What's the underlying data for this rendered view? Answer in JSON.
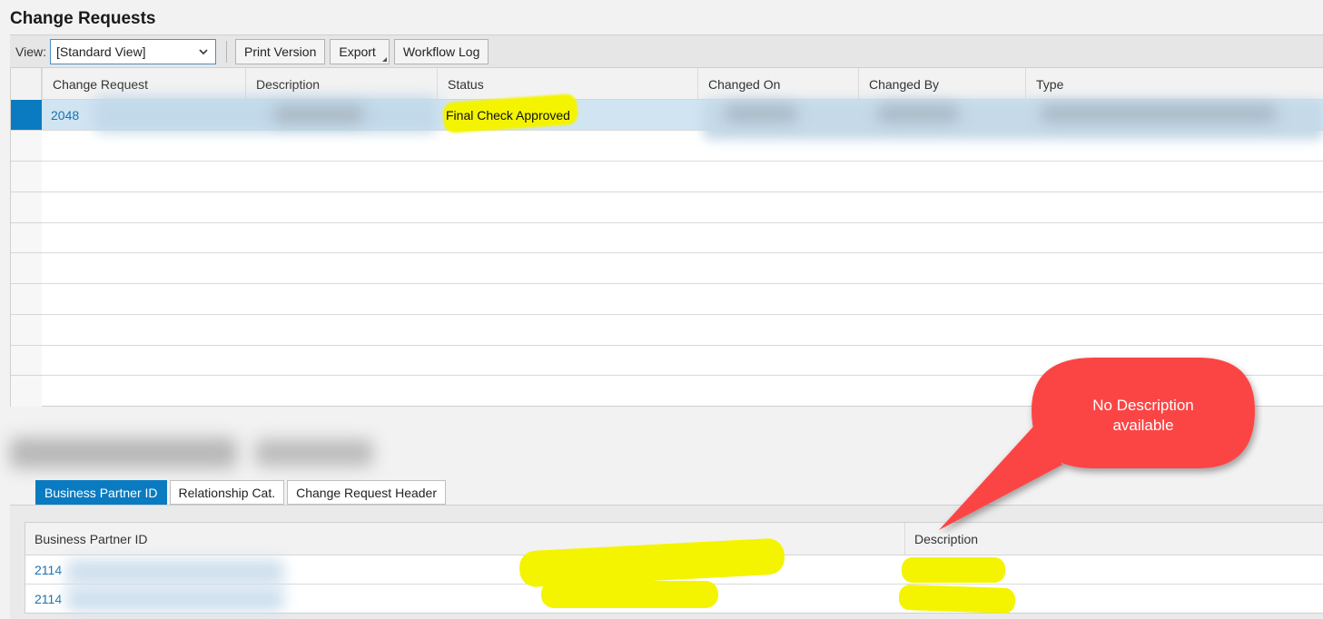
{
  "page": {
    "title": "Change Requests"
  },
  "toolbar": {
    "view_label": "View:",
    "view_value": "[Standard View]",
    "print_label": "Print Version",
    "export_label": "Export",
    "workflow_label": "Workflow Log"
  },
  "grid": {
    "columns": [
      "Change Request",
      "Description",
      "Status",
      "Changed On",
      "Changed By",
      "Type"
    ],
    "rows": [
      {
        "change_request": "2048",
        "status": "Final Check Approved"
      }
    ]
  },
  "tabs": [
    "Business Partner ID",
    "Relationship Cat.",
    "Change Request Header"
  ],
  "sub_table": {
    "columns": [
      "Business Partner ID",
      "Description"
    ],
    "rows": [
      {
        "id": "2114"
      },
      {
        "id": "2114"
      }
    ]
  },
  "callout": {
    "text_line1": "No Description",
    "text_line2": "available",
    "color": "#fb4444"
  },
  "colors": {
    "accent": "#0a7bc1",
    "link": "#1a73b0",
    "highlight": "#f4f400"
  }
}
